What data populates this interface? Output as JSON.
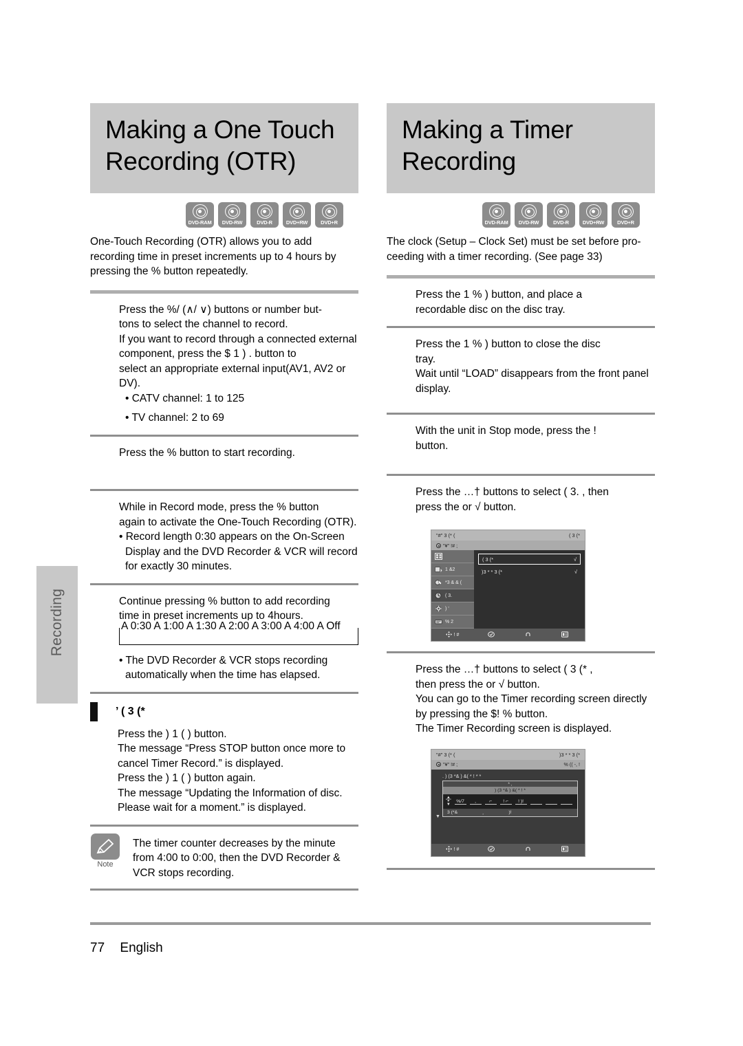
{
  "page": {
    "number": "77",
    "language": "English",
    "side_tab": "Recording"
  },
  "disc_labels": [
    "DVD-RAM",
    "DVD-RW",
    "DVD-R",
    "DVD+RW",
    "DVD+R"
  ],
  "left_column": {
    "title_line1": "Making a One Touch",
    "title_line2": "Recording (OTR)",
    "intro": "One-Touch Recording (OTR) allows you to add recording time in preset increments up to 4 hours by pressing the  %   button repeatedly.",
    "steps": [
      {
        "lines": [
          "Press the %/          (∧/ ∨) buttons or number but-",
          "tons to select the channel to record.",
          "If you want to record through a connected external",
          "component, press the $ 1  ) .         button to",
          "select an appropriate external input(AV1, AV2 or",
          "DV)."
        ],
        "bullets": [
          "• CATV channel: 1 to 125",
          "• TV channel: 2 to 69"
        ]
      },
      {
        "lines": [
          "Press the  %   button to start recording."
        ],
        "bullets": []
      },
      {
        "lines": [
          "While in Record mode, press the  %   button",
          "again to activate the One-Touch Recording (OTR)."
        ],
        "bullets": [
          "• Record length 0:30 appears on the On-Screen Display and the DVD Recorder & VCR will record for exactly 30 minutes."
        ]
      },
      {
        "lines": [
          "Continue pressing   %   button to add recording",
          "time in preset increments up to 4hours."
        ],
        "bullets": []
      }
    ],
    "sequence_box": "A 0:30 A  1:00 A  1:30 A  2:00 A  3:00 A  4:00 A  Off",
    "sequence_bullet": "• The DVD Recorder & VCR stops recording automatically when the time has elapsed.",
    "subhead": "’ ( 3 (*",
    "stop_lines": [
      "Press the )  1     (  ) button.",
      "The message “Press STOP button once more to",
      "cancel Timer Record.” is displayed.",
      "Press the )  1     (  ) button again.",
      "The message “Updating the Information of disc.",
      "Please wait for a moment.” is displayed."
    ],
    "note": {
      "caption": "Note",
      "text": "The timer counter decreases by the minute from 4:00 to 0:00, then the DVD Recorder & VCR stops recording."
    }
  },
  "right_column": {
    "title_line1": "Making a Timer",
    "title_line2": "Recording",
    "intro": "The clock (Setup – Clock Set) must be set before pro-ceeding with a timer recording. (See page 33)",
    "steps": [
      {
        "lines": [
          "Press the  1   %  )              button, and place a",
          "recordable disc on the disc tray."
        ]
      },
      {
        "lines": [
          "Press the  1   %  )              button to close the disc",
          "tray.",
          "Wait until “LOAD” disappears from the front panel",
          "display."
        ]
      },
      {
        "lines": [
          "With the unit in Stop mode, press the !",
          "button."
        ]
      },
      {
        "lines": [
          "Press the …†  buttons to select    (  3.        , then",
          "press the               or √  button."
        ]
      },
      {
        "lines": [
          "Press the …†  buttons to select    (  3 (*          ,",
          "then press the              or √  button.",
          "You can go to the Timer recording screen directly",
          "by pressing the  $!    %        button.",
          "The Timer Recording screen is displayed."
        ]
      }
    ],
    "screen1": {
      "title_left": "\"#\"  3 (* (",
      "title_right": "(   3 (*",
      "subbar_left": "\"¥\"  !#  ;",
      "sidebar": [
        {
          "icon": "film-icon",
          "label": ""
        },
        {
          "icon": "copy-icon",
          "label": "1 &2"
        },
        {
          "icon": "edit-icon",
          "label": "*3 & & ("
        },
        {
          "icon": "timer-icon",
          "label": "(  3.",
          "selected": true
        },
        {
          "icon": "setup-icon",
          "label": ")  ’"
        },
        {
          "icon": "tools-icon",
          "label": "% 2"
        }
      ],
      "rows": [
        {
          "label": "(  3 (*",
          "mark": "√",
          "selected": true
        },
        {
          "label": ")3 *  *  3 (*",
          "mark": "√",
          "selected": false
        }
      ],
      "footer": [
        {
          "icon": "dpad-icon",
          "label": "! #"
        },
        {
          "icon": "select-icon",
          "label": ""
        },
        {
          "icon": "return-icon",
          "label": ""
        },
        {
          "icon": "exit-icon",
          "label": ""
        }
      ]
    },
    "screen2": {
      "title_left": "\"#\"  3 (* (",
      "title_right": ")3 *  *  3 (*",
      "subbar_left": "\"¥\"  !#  ;",
      "subbar_right": "% ((       -,  !",
      "line1": ".          ) (3     *&    ) &(      *  ! *  *",
      "panel_top": "* ,",
      "panel_header": ") (3    *&     ) &(      *     ! *",
      "row_label": "\"¥\"",
      "cells": [
        "%/7",
        ", ",
        " ⌐ ",
        "! ⌐",
        "! )!",
        "",
        "",
        ""
      ],
      "bottom": [
        "3 (*&",
        "¸",
        ")!"
      ],
      "footer": [
        {
          "icon": "dpad-icon",
          "label": "! #"
        },
        {
          "icon": "select-icon",
          "label": ""
        },
        {
          "icon": "return-icon",
          "label": ""
        },
        {
          "icon": "exit-icon",
          "label": ""
        }
      ]
    }
  }
}
